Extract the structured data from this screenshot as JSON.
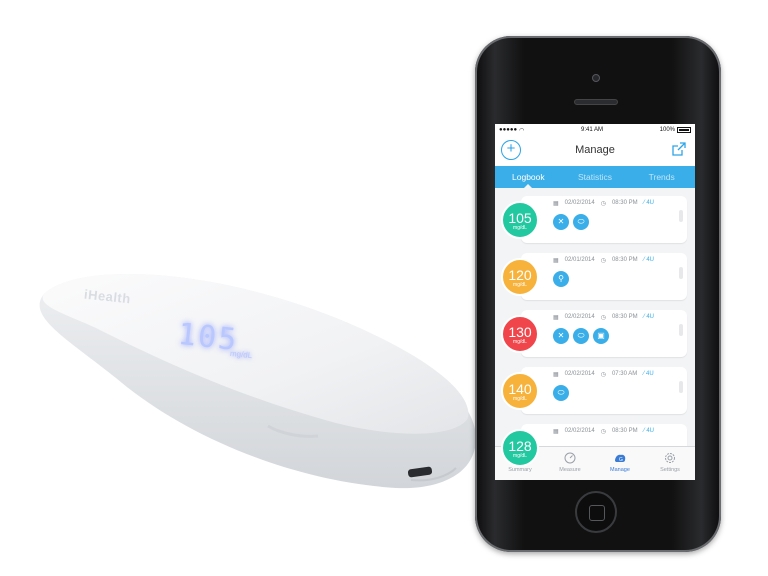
{
  "device": {
    "brand": "iHealth",
    "reading": "105",
    "unit": "mg/dL"
  },
  "status_bar": {
    "signal": "●●●●●",
    "time": "9:41 AM",
    "battery": "100%"
  },
  "header": {
    "title": "Manage",
    "add_icon": "plus-circle-icon",
    "share_icon": "share-icon"
  },
  "tabs": [
    {
      "label": "Logbook",
      "active": true
    },
    {
      "label": "Statistics",
      "active": false
    },
    {
      "label": "Trends",
      "active": false
    }
  ],
  "entries": [
    {
      "value": "105",
      "unit": "mg/dL",
      "color": "#22c9a0",
      "date": "02/02/2014",
      "time": "08:30 PM",
      "dose": "4U",
      "tags": [
        "utensils-icon",
        "pill-icon"
      ]
    },
    {
      "value": "120",
      "unit": "mg/dL",
      "color": "#f7b23b",
      "date": "02/01/2014",
      "time": "08:30 PM",
      "dose": "4U",
      "tags": [
        "running-icon"
      ]
    },
    {
      "value": "130",
      "unit": "mg/dL",
      "color": "#f0454a",
      "date": "02/02/2014",
      "time": "08:30 PM",
      "dose": "4U",
      "tags": [
        "utensils-icon",
        "pill-icon",
        "photo-icon"
      ]
    },
    {
      "value": "140",
      "unit": "mg/dL",
      "color": "#f7b23b",
      "date": "02/02/2014",
      "time": "07:30 AM",
      "dose": "4U",
      "tags": [
        "pill-icon"
      ]
    },
    {
      "value": "128",
      "unit": "mg/dL",
      "color": "#22c9a0",
      "date": "02/02/2014",
      "time": "08:30 PM",
      "dose": "4U",
      "tags": []
    }
  ],
  "tabbar": [
    {
      "label": "Summary",
      "icon": "clipboard-icon",
      "active": false
    },
    {
      "label": "Measure",
      "icon": "gauge-icon",
      "active": false
    },
    {
      "label": "Manage",
      "icon": "manage-icon",
      "active": true
    },
    {
      "label": "Settings",
      "icon": "gear-icon",
      "active": false
    }
  ]
}
